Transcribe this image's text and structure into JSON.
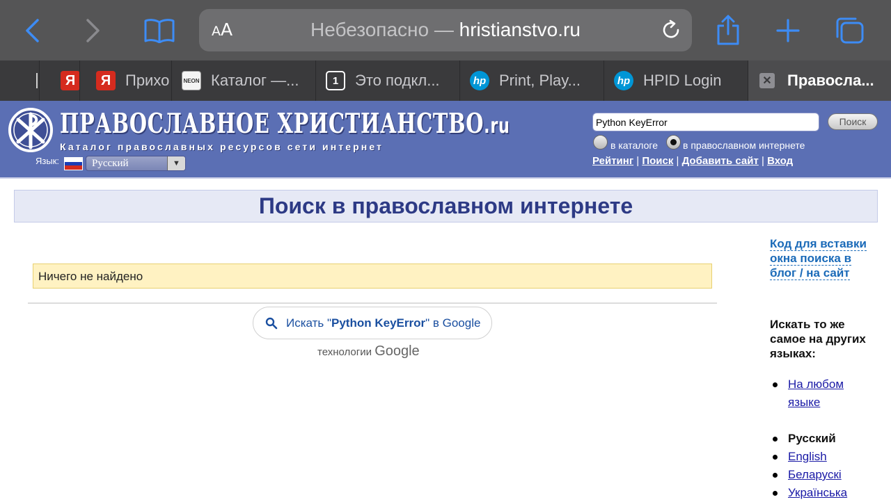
{
  "browser": {
    "aa_small": "A",
    "aa_big": "A",
    "url_prefix": "Небезопасно —",
    "url_domain": "hristianstvo.ru",
    "tabs": [
      {
        "title": "",
        "favicon": "blank"
      },
      {
        "title": "",
        "favicon": "yandex",
        "glyph": "Я"
      },
      {
        "title": "Прихо",
        "favicon": "yandex",
        "glyph": "Я"
      },
      {
        "title": "Каталог —...",
        "favicon": "neon",
        "glyph": "NEON"
      },
      {
        "title": "Это подкл...",
        "favicon": "one",
        "glyph": "1"
      },
      {
        "title": "Print, Play...",
        "favicon": "hp",
        "glyph": "hp"
      },
      {
        "title": "HPID Login",
        "favicon": "hp",
        "glyph": "hp"
      },
      {
        "title": "Правосла...",
        "favicon": "close",
        "glyph": "✕",
        "active": true
      }
    ]
  },
  "site": {
    "logo_title": "ПРАВОСЛАВНОЕ ХРИСТИАНСТВО",
    "logo_tld": ".ru",
    "logo_subtitle": "Каталог православных ресурсов сети интернет",
    "lang_label": "Язык:",
    "lang_value": "Русский",
    "search_value": "Python KeyError",
    "search_button": "Поиск",
    "radio_catalog": "в каталоге",
    "radio_internet": "в православном интернете",
    "links": {
      "rating": "Рейтинг",
      "search": "Поиск",
      "add_site": "Добавить сайт",
      "login": "Вход"
    }
  },
  "main": {
    "heading": "Поиск в православном интернете",
    "not_found": "Ничего не найдено",
    "google_prefix": "Искать \"",
    "google_query": "Python KeyError",
    "google_suffix": "\" в Google",
    "powered_prefix": "технологии",
    "powered_brand": "Google"
  },
  "sidebar": {
    "embed_link": "Код для вставки окна поиска в блог / на сайт",
    "other_langs_title": "Искать то же самое на других языках:",
    "any_lang": "На любом языке",
    "languages": [
      {
        "label": "Русский",
        "current": true
      },
      {
        "label": "English",
        "current": false
      },
      {
        "label": "Беларускі",
        "current": false
      },
      {
        "label": "Українська",
        "current": false
      }
    ]
  },
  "colors": {
    "toolbar": "#555556",
    "tabbar": "#3a3a3c",
    "site_header": "#5b6fb4",
    "heading_text": "#2d3a85",
    "notice_bg": "#fff2c2",
    "link": "#1a6ab8"
  }
}
